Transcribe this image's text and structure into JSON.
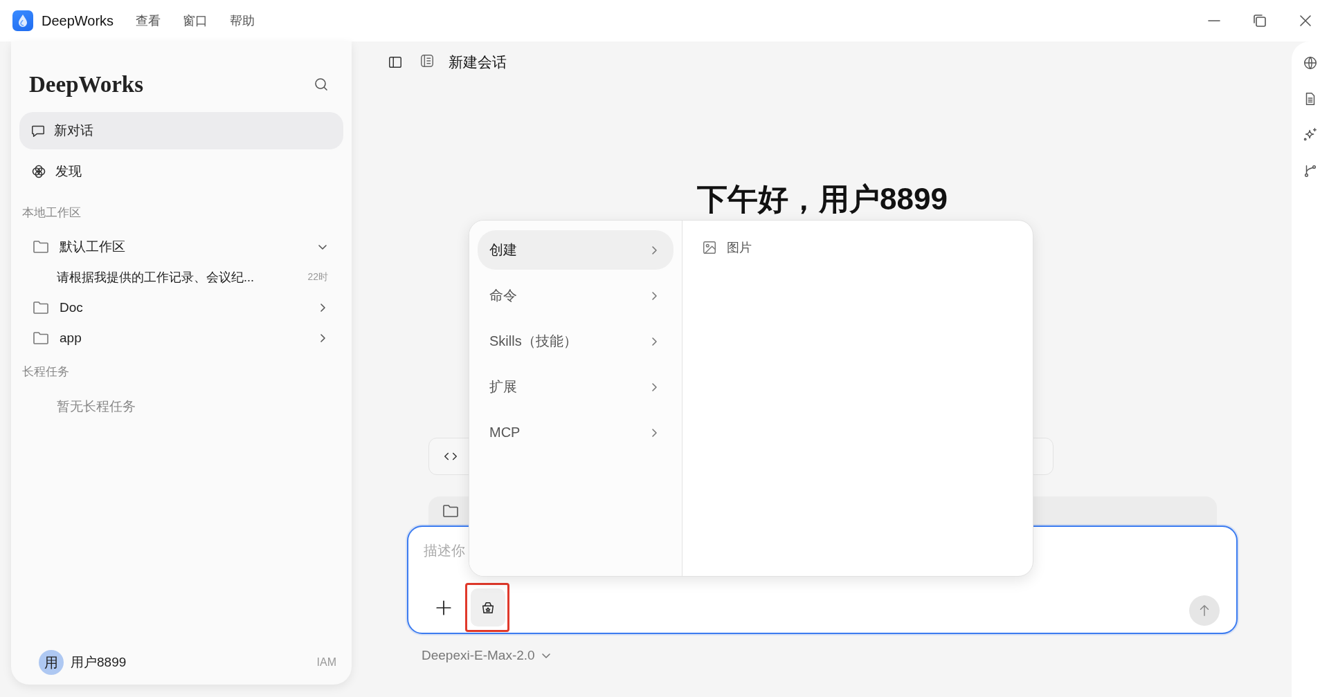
{
  "app": {
    "name": "DeepWorks",
    "menus": [
      "查看",
      "窗口",
      "帮助"
    ]
  },
  "sidebar": {
    "title": "DeepWorks",
    "nav": [
      {
        "label": "新对话",
        "selected": true,
        "kind": "chat"
      },
      {
        "label": "发现",
        "selected": false,
        "kind": "discover"
      }
    ],
    "workspace_heading": "本地工作区",
    "workspaces": [
      {
        "name": "默认工作区",
        "expanded": true,
        "children": [
          {
            "title": "请根据我提供的工作记录、会议纪...",
            "time": "22时"
          }
        ]
      },
      {
        "name": "Doc",
        "expanded": false
      },
      {
        "name": "app",
        "expanded": false
      }
    ],
    "tasks_heading": "长程任务",
    "tasks_empty": "暂无长程任务",
    "user": {
      "avatar": "用",
      "name": "用户8899",
      "badge": "IAM"
    }
  },
  "header": {
    "title": "新建会话"
  },
  "greeting": "下午好，用户8899",
  "composer": {
    "placeholder": "描述你",
    "model": "Deepexi-E-Max-2.0",
    "skills_highlighted": true
  },
  "popup": {
    "categories": [
      {
        "label": "创建",
        "selected": true
      },
      {
        "label": "命令",
        "selected": false
      },
      {
        "label": "Skills（技能）",
        "selected": false
      },
      {
        "label": "扩展",
        "selected": false
      },
      {
        "label": "MCP",
        "selected": false
      }
    ],
    "items": [
      {
        "label": "图片"
      }
    ]
  }
}
